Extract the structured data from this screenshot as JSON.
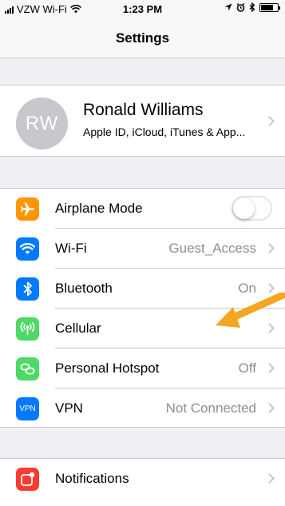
{
  "status_bar": {
    "carrier": "VZW Wi-Fi",
    "time": "1:23 PM",
    "icons": [
      "signal-icon",
      "wifi-icon",
      "location-icon",
      "alarm-icon",
      "bluetooth-icon",
      "battery-icon"
    ]
  },
  "nav": {
    "title": "Settings"
  },
  "profile": {
    "initials": "RW",
    "name": "Ronald Williams",
    "subtitle": "Apple ID, iCloud, iTunes & App..."
  },
  "settings": {
    "airplane": {
      "label": "Airplane Mode",
      "icon": "airplane-icon",
      "color": "#ff9500",
      "toggle_on": false
    },
    "wifi": {
      "label": "Wi-Fi",
      "value": "Guest_Access",
      "icon": "wifi-icon",
      "color": "#007aff"
    },
    "bluetooth": {
      "label": "Bluetooth",
      "value": "On",
      "icon": "bluetooth-icon",
      "color": "#007aff"
    },
    "cellular": {
      "label": "Cellular",
      "icon": "cellular-icon",
      "color": "#4cd964"
    },
    "hotspot": {
      "label": "Personal Hotspot",
      "value": "Off",
      "icon": "hotspot-icon",
      "color": "#4cd964"
    },
    "vpn": {
      "label": "VPN",
      "value": "Not Connected",
      "icon_text": "VPN",
      "color": "#007aff"
    }
  },
  "notifications": {
    "label": "Notifications",
    "icon": "notifications-icon",
    "color": "#ff3b30"
  },
  "annotation": {
    "icon": "arrow-annotation",
    "color": "#f5a623"
  }
}
